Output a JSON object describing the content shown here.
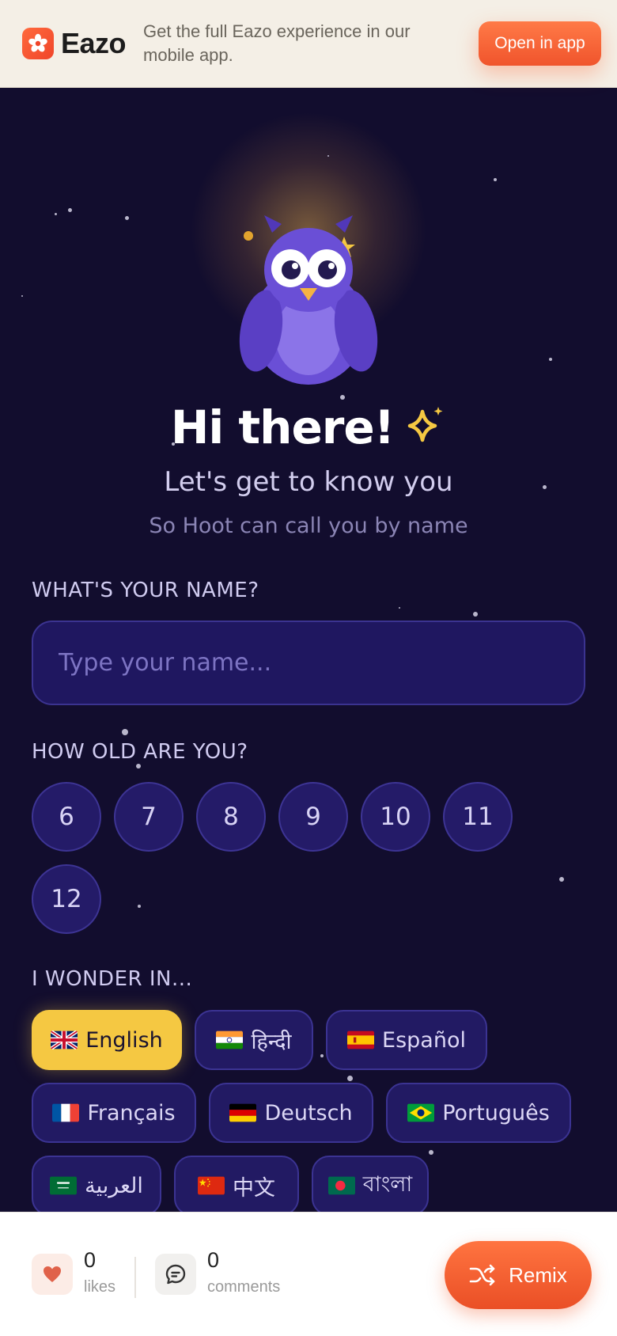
{
  "banner": {
    "brand_name": "Eazo",
    "message": "Get the full Eazo experience in our mobile app.",
    "open_app_label": "Open in app"
  },
  "hero": {
    "title": "Hi there!",
    "subtitle": "Let's get to know you",
    "hint": "So Hoot can call you by name"
  },
  "name_section": {
    "label": "WHAT'S YOUR NAME?",
    "placeholder": "Type your name...",
    "value": ""
  },
  "age_section": {
    "label": "HOW OLD ARE YOU?",
    "options": [
      "6",
      "7",
      "8",
      "9",
      "10",
      "11",
      "12"
    ]
  },
  "language_section": {
    "label": "I WONDER IN...",
    "selected": "English",
    "options": [
      {
        "label": "English",
        "flag": "uk-flag"
      },
      {
        "label": "हिन्दी",
        "flag": "india-flag"
      },
      {
        "label": "Español",
        "flag": "spain-flag"
      },
      {
        "label": "Français",
        "flag": "france-flag"
      },
      {
        "label": "Deutsch",
        "flag": "germany-flag"
      },
      {
        "label": "Português",
        "flag": "brazil-flag"
      },
      {
        "label": "العربية",
        "flag": "saudi-flag"
      },
      {
        "label": "中文",
        "flag": "china-flag"
      },
      {
        "label": "বাংলা",
        "flag": "bangladesh-flag"
      }
    ]
  },
  "footer": {
    "likes_count": "0",
    "likes_label": "likes",
    "comments_count": "0",
    "comments_label": "comments",
    "remix_label": "Remix"
  },
  "colors": {
    "background": "#120d2e",
    "accent_orange": "#f0542c",
    "selected_yellow": "#f5c842",
    "owl_purple": "#6a4fd6"
  }
}
